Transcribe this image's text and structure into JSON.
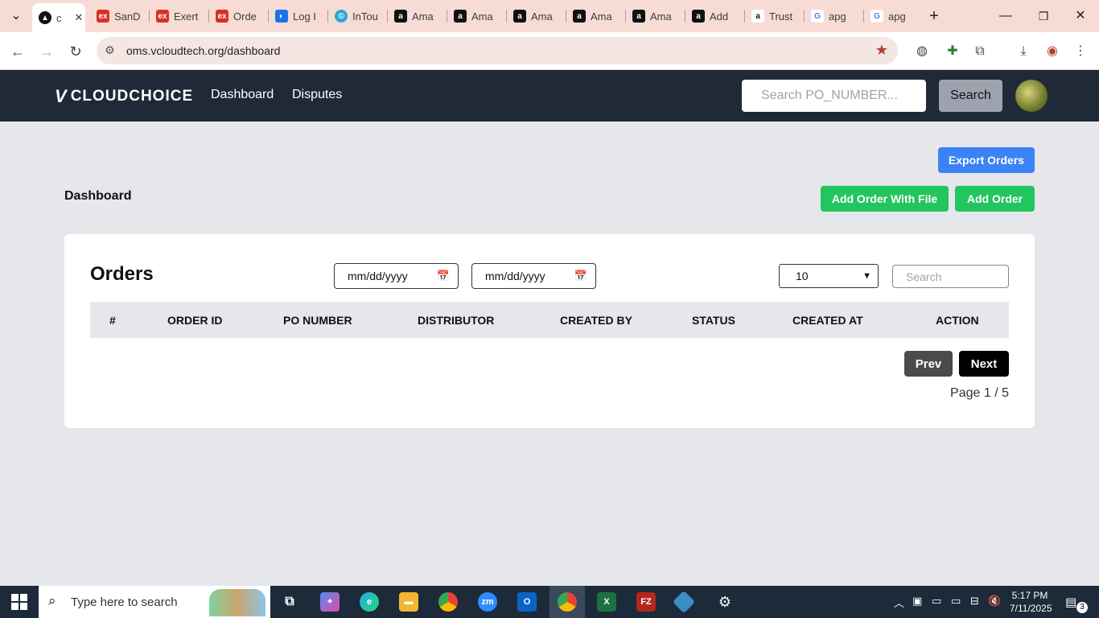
{
  "browser": {
    "tabs": [
      {
        "label": "c",
        "icon": "site-icon",
        "active": true
      },
      {
        "label": "SanD",
        "icon": "ex-icon"
      },
      {
        "label": "Exert",
        "icon": "ex-icon"
      },
      {
        "label": "Orde",
        "icon": "ex-icon"
      },
      {
        "label": "Log I",
        "icon": "login-icon"
      },
      {
        "label": "InTou",
        "icon": "intouch-icon"
      },
      {
        "label": "Ama",
        "icon": "amazon-icon"
      },
      {
        "label": "Ama",
        "icon": "amazon-icon"
      },
      {
        "label": "Ama",
        "icon": "amazon-icon"
      },
      {
        "label": "Ama",
        "icon": "amazon-icon"
      },
      {
        "label": "Ama",
        "icon": "amazon-icon"
      },
      {
        "label": "Add",
        "icon": "amazon-icon"
      },
      {
        "label": "Trust",
        "icon": "amazon-smile-icon"
      },
      {
        "label": "apg",
        "icon": "google-icon"
      },
      {
        "label": "apg",
        "icon": "google-icon"
      }
    ],
    "url": "oms.vcloudtech.org/dashboard"
  },
  "app": {
    "logo": "CLOUDCHOICE",
    "nav": {
      "dashboard": "Dashboard",
      "disputes": "Disputes"
    },
    "search_placeholder": "Search PO_NUMBER...",
    "search_button": "Search"
  },
  "actions": {
    "export": "Export Orders",
    "add_with_file": "Add Order With File",
    "add": "Add Order"
  },
  "page_title": "Dashboard",
  "orders": {
    "title": "Orders",
    "date_from": "mm/dd/yyyy",
    "date_to": "mm/dd/yyyy",
    "page_size": "10",
    "search_placeholder": "Search",
    "columns": [
      "#",
      "ORDER ID",
      "PO NUMBER",
      "DISTRIBUTOR",
      "CREATED BY",
      "STATUS",
      "CREATED AT",
      "ACTION"
    ],
    "rows": [],
    "prev": "Prev",
    "next": "Next",
    "page_info": "Page 1 / 5"
  },
  "taskbar": {
    "search_placeholder": "Type here to search",
    "time": "5:17 PM",
    "date": "7/11/2025",
    "notifications": "3"
  }
}
